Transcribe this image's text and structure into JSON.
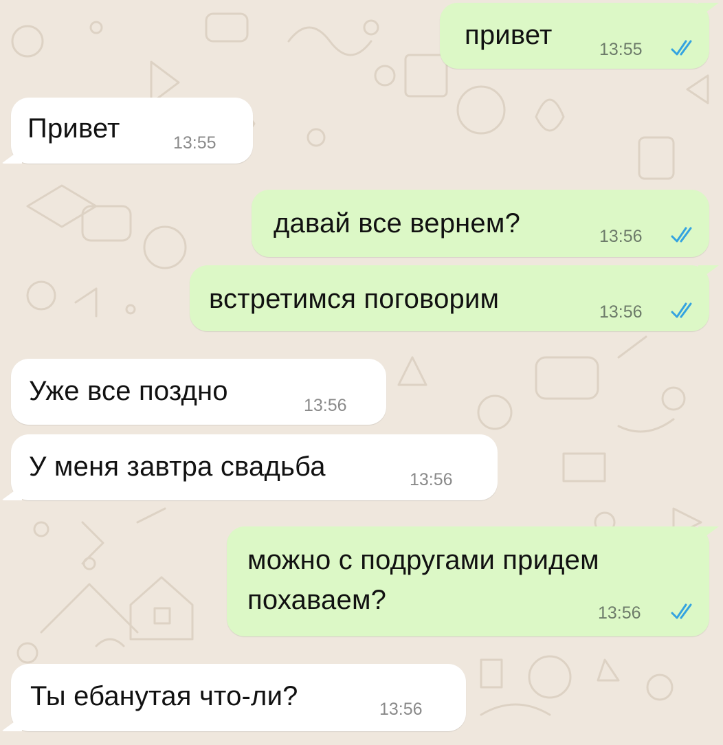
{
  "colors": {
    "wallpaper": "#efe7dd",
    "incoming_bubble": "#ffffff",
    "outgoing_bubble": "#dcf8c6",
    "read_ticks": "#34a3e0"
  },
  "messages": [
    {
      "direction": "out",
      "text": "привет",
      "time": "13:55",
      "status_icon": "double-check-read-icon"
    },
    {
      "direction": "in",
      "text": "Привет",
      "time": "13:55"
    },
    {
      "direction": "out",
      "text": "давай все вернем?",
      "time": "13:56",
      "status_icon": "double-check-read-icon"
    },
    {
      "direction": "out",
      "text": "встретимся поговорим",
      "time": "13:56",
      "status_icon": "double-check-read-icon"
    },
    {
      "direction": "in",
      "text": "Уже все поздно",
      "time": "13:56"
    },
    {
      "direction": "in",
      "text": "У меня завтра свадьба",
      "time": "13:56"
    },
    {
      "direction": "out",
      "text_lines": [
        "можно с подругами придем",
        "похаваем?"
      ],
      "time": "13:56",
      "status_icon": "double-check-read-icon"
    },
    {
      "direction": "in",
      "text": "Ты ебанутая что-ли?",
      "time": "13:56"
    }
  ]
}
